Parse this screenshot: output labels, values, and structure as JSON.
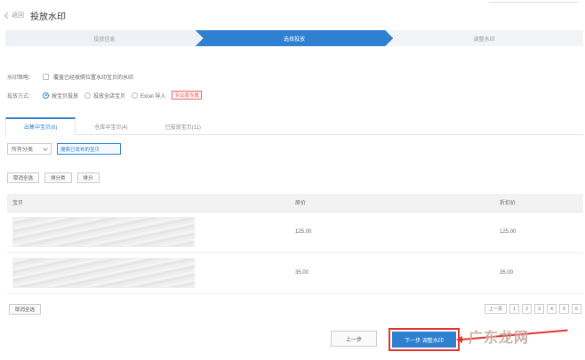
{
  "header": {
    "back_label": "返回",
    "title": "投放水印"
  },
  "steps": [
    "投放信息",
    "选择投放",
    "调整水印"
  ],
  "options": {
    "row1_label": "水印策略：",
    "row1_checkbox": "覆盖已经按照位置水印宝贝的水印",
    "row2_label": "投放方式：",
    "radios": [
      "按宝贝投放",
      "投放全店宝贝",
      "Excel 导入"
    ],
    "badge": "专业版专属"
  },
  "tabs": [
    "出售中宝贝(6)",
    "仓库中宝贝(4)",
    "已投放宝贝(11)"
  ],
  "filter": {
    "select_value": "所有分类",
    "search_placeholder": "搜索已发布的宝贝"
  },
  "actions": [
    "取消全选",
    "排分类",
    "排分"
  ],
  "table": {
    "headers": [
      "宝贝",
      "原价",
      "折扣价"
    ],
    "rows": [
      {
        "price": "125.00",
        "discount": "125.00"
      },
      {
        "price": "35.00",
        "discount": "35.00"
      }
    ]
  },
  "bottom": {
    "select_all": "取消全选",
    "pagination": [
      "上一页",
      "1",
      "2",
      "3",
      "4",
      "5",
      "6"
    ],
    "prev_button": "上一步",
    "next_button": "下一步 调整水印"
  },
  "watermark_text": "广东龙网",
  "colors": {
    "accent": "#2f80d1",
    "highlight": "#e0342c"
  }
}
